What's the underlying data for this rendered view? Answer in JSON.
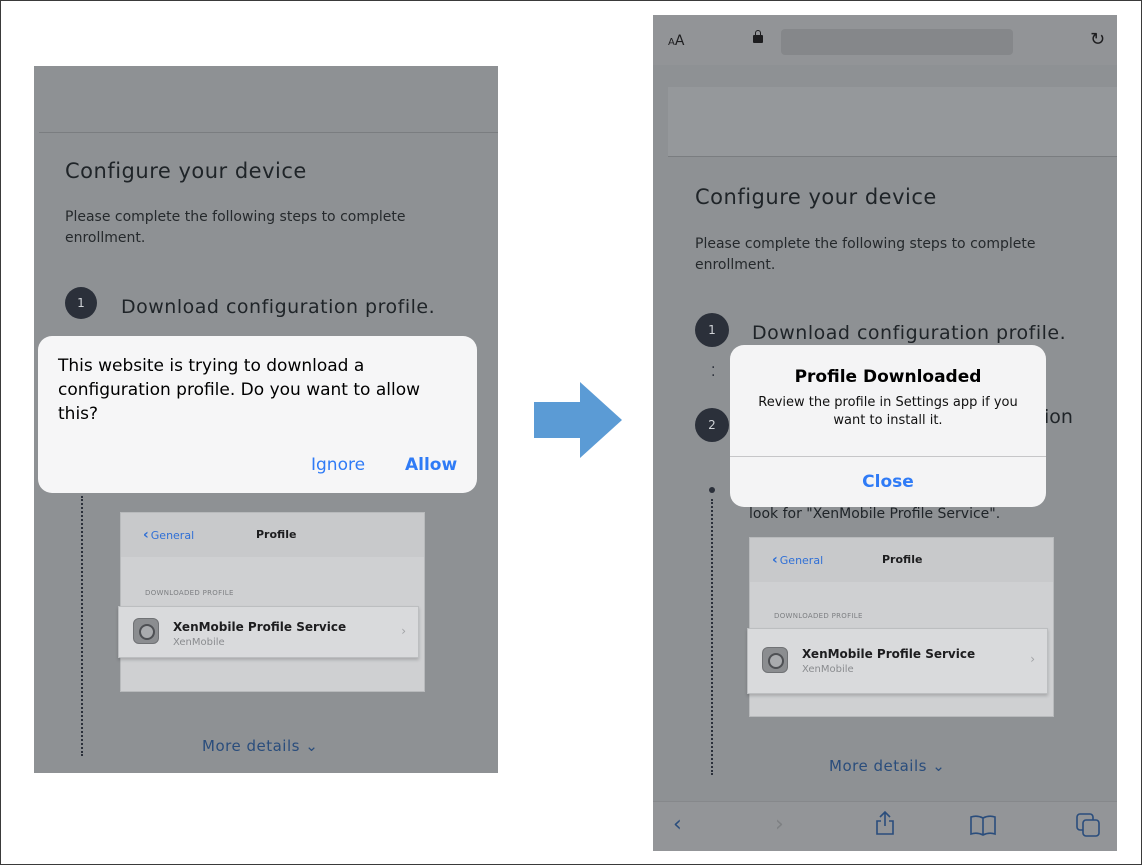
{
  "left": {
    "title": "Configure your device",
    "intro": "Please complete the following steps to complete enrollment.",
    "step1": {
      "number": "1",
      "text": "Download configuration profile."
    },
    "dialog": {
      "message": "This website is trying to download a configuration profile. Do you want to allow this?",
      "ignore": "Ignore",
      "allow": "Allow"
    },
    "card": {
      "back": "General",
      "title": "Profile",
      "section": "DOWNLOADED PROFILE",
      "row_title": "XenMobile Profile Service",
      "row_sub": "XenMobile"
    },
    "more": "More details"
  },
  "right": {
    "aa": "AA",
    "title": "Configure your device",
    "intro": "Please complete the following steps to complete enrollment.",
    "step1": {
      "number": "1",
      "text": "Download configuration profile."
    },
    "step2": {
      "number": "2",
      "tail": "ion"
    },
    "lookfor": "look for \"XenMobile Profile Service\".",
    "dialog": {
      "title": "Profile Downloaded",
      "message": "Review the profile in Settings app if you want to install it.",
      "close": "Close"
    },
    "card": {
      "back": "General",
      "title": "Profile",
      "section": "DOWNLOADED PROFILE",
      "row_title": "XenMobile Profile Service",
      "row_sub": "XenMobile"
    },
    "more": "More details",
    "toolbar_icons": [
      "back-icon",
      "forward-icon",
      "share-icon",
      "bookmarks-icon",
      "tabs-icon"
    ]
  },
  "colors": {
    "accent": "#2f7bf6",
    "arrow": "#5b9bd5",
    "overlay": "#8e9194"
  }
}
